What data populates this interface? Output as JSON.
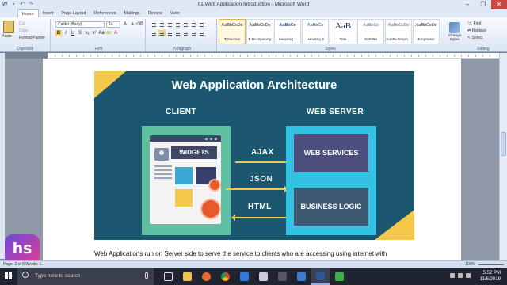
{
  "window": {
    "title": "01 Web Application Introduction - Microsoft Word",
    "controls": [
      "–",
      "❐",
      "✕"
    ]
  },
  "tabs": [
    "Home",
    "Insert",
    "Page Layout",
    "References",
    "Mailings",
    "Review",
    "View"
  ],
  "ribbon": {
    "clipboard": {
      "paste": "Paste",
      "cut": "Cut",
      "copy": "Copy",
      "format_painter": "Format Painter",
      "label": "Clipboard"
    },
    "font": {
      "family": "Calibri (Body)",
      "size": "14",
      "label": "Font"
    },
    "paragraph": {
      "label": "Paragraph"
    },
    "styles": {
      "label": "Styles",
      "items": [
        {
          "sample": "AaBbCcDc",
          "name": "¶ Normal"
        },
        {
          "sample": "AaBbCcDc",
          "name": "¶ No Spacing"
        },
        {
          "sample": "AaBbCc",
          "name": "Heading 1"
        },
        {
          "sample": "AaBbCc",
          "name": "Heading 2"
        },
        {
          "sample": "AaB",
          "name": "Title"
        },
        {
          "sample": "AaBbCc",
          "name": "Subtitle"
        },
        {
          "sample": "AaBbCcDc",
          "name": "Subtle Emph..."
        },
        {
          "sample": "AaBbCcDc",
          "name": "Emphasis"
        }
      ],
      "change_styles": "Change Styles"
    },
    "editing": {
      "find": "Find",
      "replace": "Replace",
      "select": "Select",
      "label": "Editing"
    }
  },
  "slide": {
    "title": "Web Application Architecture",
    "client_header": "CLIENT",
    "server_header": "WEB SERVER",
    "widgets": "WIDGETS",
    "protocols": [
      "AJAX",
      "JSON",
      "HTML"
    ],
    "web_services": "WEB SERVICES",
    "business_logic": "BUSINESS LOGIC"
  },
  "document": {
    "body_text": "Web Applications run on Server side to serve the service to clients who are accessing using internet with"
  },
  "logo": {
    "text": "hs"
  },
  "status": {
    "page": "Page: 2 of 5",
    "words": "Words: 1...",
    "zoom": "100%"
  },
  "taskbar": {
    "search_placeholder": "Type here to search",
    "time": "5:52 PM",
    "date": "11/5/2019"
  },
  "colors": {
    "slide_bg": "#1b5870",
    "accent_yellow": "#f4c94b",
    "client_green": "#5ec0a0",
    "server_blue": "#33c2e3"
  }
}
